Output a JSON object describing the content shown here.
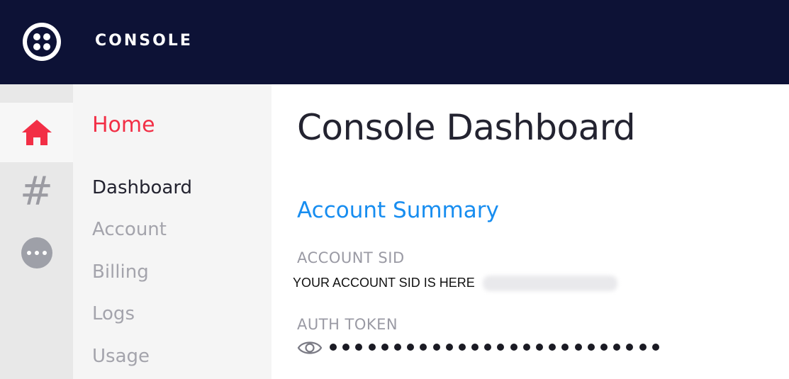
{
  "topbar": {
    "brand": "CONSOLE",
    "logo_icon": "twilio-logo-icon",
    "background": "#0d1236"
  },
  "rail": {
    "items": [
      {
        "icon": "home-icon",
        "active": true,
        "color": "#f22f46"
      },
      {
        "icon": "hash-icon",
        "glyph": "#",
        "active": false
      },
      {
        "icon": "more-dots-icon",
        "active": false
      }
    ]
  },
  "subnav": {
    "title": "Home",
    "links": [
      {
        "label": "Dashboard",
        "current": true
      },
      {
        "label": "Account",
        "current": false
      },
      {
        "label": "Billing",
        "current": false
      },
      {
        "label": "Logs",
        "current": false
      },
      {
        "label": "Usage",
        "current": false
      }
    ]
  },
  "main": {
    "title": "Console Dashboard",
    "section_title": "Account Summary",
    "account_sid": {
      "label": "ACCOUNT SID",
      "value": "YOUR ACCOUNT SID IS HERE"
    },
    "auth_token": {
      "label": "AUTH TOKEN",
      "masked_dot_count": 26,
      "visibility_icon": "eye-icon"
    }
  },
  "colors": {
    "accent_red": "#f22f46",
    "link_blue": "#178df0"
  }
}
